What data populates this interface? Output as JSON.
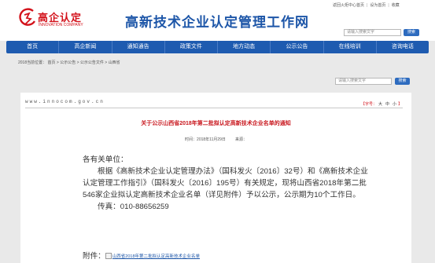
{
  "brand": {
    "logo_cn": "高企认定",
    "logo_en": "INNOVATION COMPANY",
    "site_title": "高新技术企业认定管理工作网",
    "primary_color": "#1e5bb0",
    "accent_color": "#d3121b"
  },
  "toplinks": [
    "返回火炬中心首页",
    "设为首页",
    "收藏"
  ],
  "top_search": {
    "placeholder": "请输入搜索文字",
    "button": "搜索"
  },
  "nav": [
    "首页",
    "高企新闻",
    "通知通告",
    "政策文件",
    "地方动态",
    "公示公告",
    "在线培训",
    "咨询电话"
  ],
  "breadcrumb": "2018当前位置：  首页 > 公示公告 > 公示公告文件 > 山西省",
  "sub_search": {
    "placeholder": "请输入搜索文字",
    "button": "搜索"
  },
  "article": {
    "domain": "www.innocom.gov.cn",
    "font_size_label": "【字号：",
    "font_size_options": [
      "大",
      "中",
      "小"
    ],
    "font_size_close": "】",
    "headline": "关于公示山西省2018年第二批拟认定高新技术企业名单的通知",
    "time_label": "时间：2018年11月29日",
    "source_label": "来源：",
    "addressee": "各有关单位：",
    "paragraph": "根据《高新技术企业认定管理办法》（国科发火〔2016〕32号）和《高新技术企业认定管理工作指引》（国科发火〔2016〕195号）有关规定，现将山西省2018年第二批546家企业拟认定高新技术企业名单（详见附件）予以公示，公示期为10个工作日。",
    "fax": "传真：010-88656259",
    "attachment_label": "附件：",
    "attachment_link": "山西省2018年第二批拟认定高新技术企业名单"
  }
}
